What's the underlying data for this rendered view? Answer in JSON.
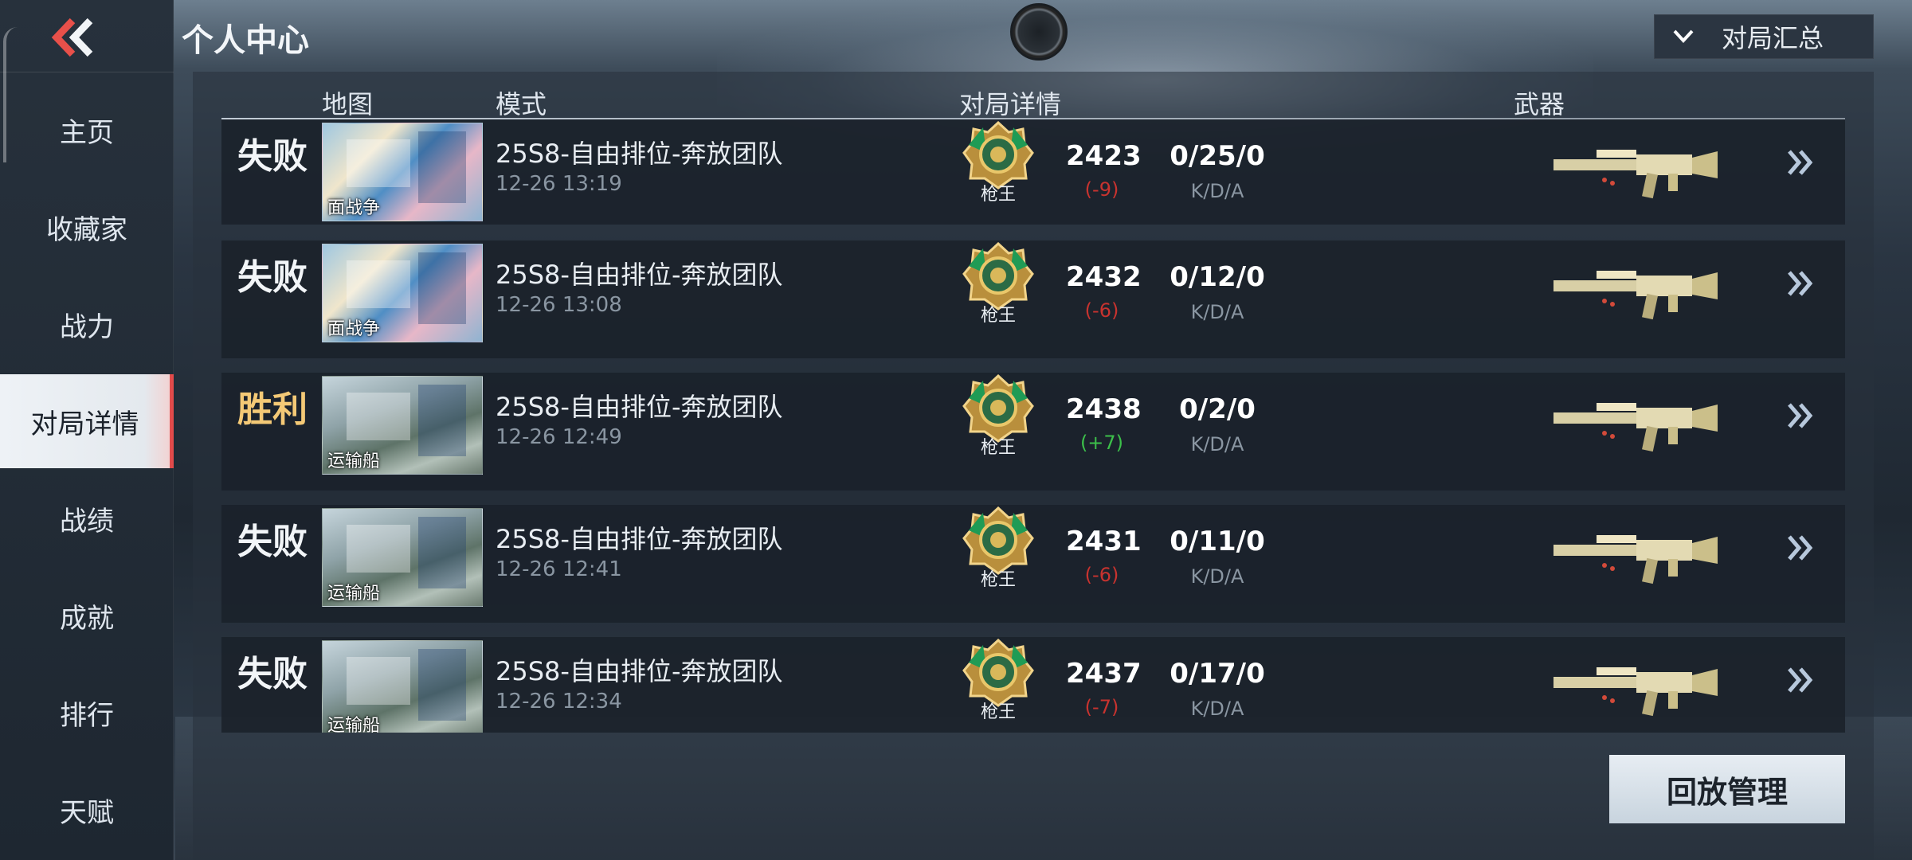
{
  "header": {
    "title": "个人中心",
    "summary_dropdown": {
      "label": "对局汇总",
      "icon": "chevron-down-icon"
    }
  },
  "sidebar": {
    "back_icon": "double-chevron-left-icon",
    "items": [
      {
        "label": "主页",
        "active": false
      },
      {
        "label": "收藏家",
        "active": false
      },
      {
        "label": "战力",
        "active": false
      },
      {
        "label": "对局详情",
        "active": true
      },
      {
        "label": "战绩",
        "active": false
      },
      {
        "label": "成就",
        "active": false
      },
      {
        "label": "排行",
        "active": false
      },
      {
        "label": "天赋",
        "active": false
      }
    ]
  },
  "table": {
    "columns": {
      "map": "地图",
      "mode": "模式",
      "detail": "对局详情",
      "weapon": "武器"
    },
    "rows": [
      {
        "result": "失败",
        "win": false,
        "map_name": "面战争",
        "map_style": "station",
        "mode": "25S8-自由排位-奔放团队",
        "time": "12-26 13:19",
        "rank": "枪王",
        "score": "2423",
        "delta": "(-9)",
        "kda": "0/25/0",
        "kda_label": "K/D/A"
      },
      {
        "result": "失败",
        "win": false,
        "map_name": "面战争",
        "map_style": "station",
        "mode": "25S8-自由排位-奔放团队",
        "time": "12-26 13:08",
        "rank": "枪王",
        "score": "2432",
        "delta": "(-6)",
        "kda": "0/12/0",
        "kda_label": "K/D/A"
      },
      {
        "result": "胜利",
        "win": true,
        "map_name": "运输船",
        "map_style": "ship",
        "mode": "25S8-自由排位-奔放团队",
        "time": "12-26 12:49",
        "rank": "枪王",
        "score": "2438",
        "delta": "(+7)",
        "kda": "0/2/0",
        "kda_label": "K/D/A"
      },
      {
        "result": "失败",
        "win": false,
        "map_name": "运输船",
        "map_style": "ship",
        "mode": "25S8-自由排位-奔放团队",
        "time": "12-26 12:41",
        "rank": "枪王",
        "score": "2431",
        "delta": "(-6)",
        "kda": "0/11/0",
        "kda_label": "K/D/A"
      },
      {
        "result": "失败",
        "win": false,
        "map_name": "运输船",
        "map_style": "ship",
        "mode": "25S8-自由排位-奔放团队",
        "time": "12-26 12:34",
        "rank": "枪王",
        "score": "2437",
        "delta": "(-7)",
        "kda": "0/17/0",
        "kda_label": "K/D/A"
      }
    ]
  },
  "footer": {
    "replay_button": "回放管理"
  },
  "colors": {
    "accent_red": "#e24b4b",
    "win_gold": "#f4c976",
    "loss_delta": "#c8332f",
    "win_delta": "#3cc04a"
  }
}
